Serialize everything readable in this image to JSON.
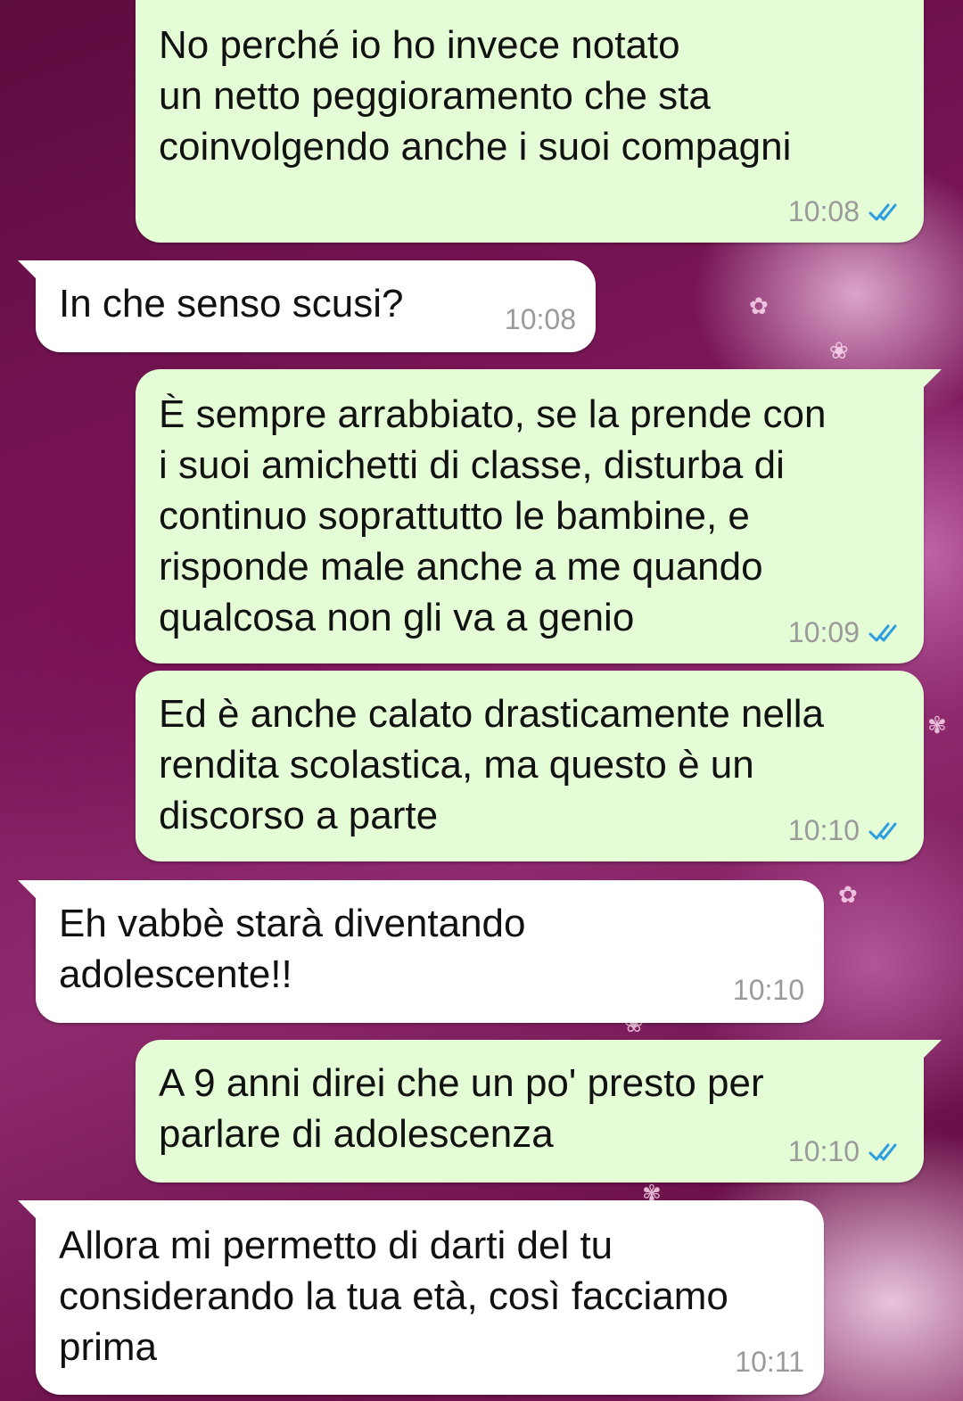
{
  "messages": [
    {
      "direction": "outgoing",
      "text": "No perché io ho invece notato\nun netto peggioramento che sta\ncoinvolgendo anche i suoi compagni",
      "time": "10:08",
      "status": "read"
    },
    {
      "direction": "incoming",
      "text": "In che senso scusi?",
      "time": "10:08"
    },
    {
      "direction": "outgoing",
      "text": "È sempre arrabbiato, se la prende con\ni suoi amichetti di classe, disturba di\ncontinuo soprattutto le bambine, e\nrisponde male anche a me quando\nqualcosa non gli va a genio",
      "time": "10:09",
      "status": "read"
    },
    {
      "direction": "outgoing",
      "text": "Ed è anche calato drasticamente nella\nrendita scolastica, ma questo è un\ndiscorso a parte",
      "time": "10:10",
      "status": "read"
    },
    {
      "direction": "incoming",
      "text": "Eh vabbè starà diventando\nadolescente!!",
      "time": "10:10"
    },
    {
      "direction": "outgoing",
      "text": "A 9 anni direi che un po' presto per\nparlare di adolescenza",
      "time": "10:10",
      "status": "read"
    },
    {
      "direction": "incoming",
      "text": "Allora mi permetto di darti del tu\nconsiderando la tua età, così facciamo\nprima",
      "time": "10:11"
    }
  ],
  "colors": {
    "outgoing_bubble": "#e4fdd6",
    "incoming_bubble": "#ffffff",
    "timestamp": "#9a9a9a",
    "read_ticks": "#2d9ee0",
    "wallpaper": "#7a1658"
  },
  "icons": {
    "read_receipt": "double-check-icon"
  }
}
